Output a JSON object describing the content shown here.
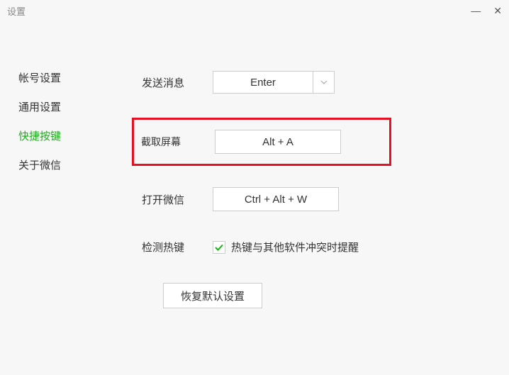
{
  "window": {
    "title": "设置"
  },
  "sidebar": {
    "items": [
      {
        "label": "帐号设置"
      },
      {
        "label": "通用设置"
      },
      {
        "label": "快捷按键"
      },
      {
        "label": "关于微信"
      }
    ]
  },
  "main": {
    "send_message": {
      "label": "发送消息",
      "value": "Enter"
    },
    "screenshot": {
      "label": "截取屏幕",
      "value": "Alt + A"
    },
    "open_wechat": {
      "label": "打开微信",
      "value": "Ctrl + Alt + W"
    },
    "detect_hotkey": {
      "label": "检测热键",
      "checkbox_text": "热键与其他软件冲突时提醒"
    },
    "restore_default": "恢复默认设置"
  }
}
